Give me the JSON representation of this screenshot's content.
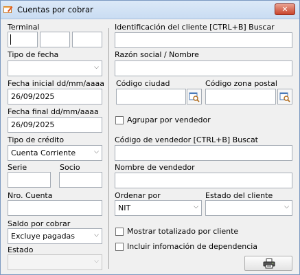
{
  "window": {
    "title": "Cuentas por cobrar",
    "close_glyph": "✕",
    "app_icon": "edit-window-icon"
  },
  "left": {
    "terminal_label": "Terminal",
    "tipo_fecha_label": "Tipo de fecha",
    "tipo_fecha_value": "",
    "fecha_inicial_label": "Fecha inicial dd/mm/aaaa",
    "fecha_inicial_value": "26/09/2025",
    "fecha_final_label": "Fecha final dd/mm/aaaa",
    "fecha_final_value": "26/09/2025",
    "tipo_credito_label": "Tipo de crédito",
    "tipo_credito_value": "Cuenta Corriente",
    "serie_label": "Serie",
    "socio_label": "Socio",
    "nro_cuenta_label": "Nro. Cuenta",
    "saldo_label": "Saldo por cobrar",
    "saldo_value": "Excluye pagadas",
    "estado_label": "Estado",
    "estado_value": ""
  },
  "right": {
    "id_cliente_label": "Identificación del cliente [CTRL+B] Buscar",
    "razon_social_label": "Razón social / Nombre",
    "codigo_ciudad_label": "Código ciudad",
    "codigo_zona_label": "Código zona postal",
    "agrupar_vendedor_label": "Agrupar por vendedor",
    "codigo_vendedor_label": "Código de vendedor [CTRL+B] Buscat",
    "nombre_vendedor_label": "Nombre de vendedor",
    "ordenar_label": "Ordenar por",
    "ordenar_value": "NIT",
    "estado_cliente_label": "Estado del cliente",
    "estado_cliente_value": "",
    "mostrar_totalizado_label": "Mostrar totalizado por cliente",
    "incluir_dependencia_label": "Incluir infomación de dependencia"
  },
  "icons": {
    "select_chevron": "⌵",
    "lookup": "search-lookup-icon",
    "print": "printer-icon"
  }
}
